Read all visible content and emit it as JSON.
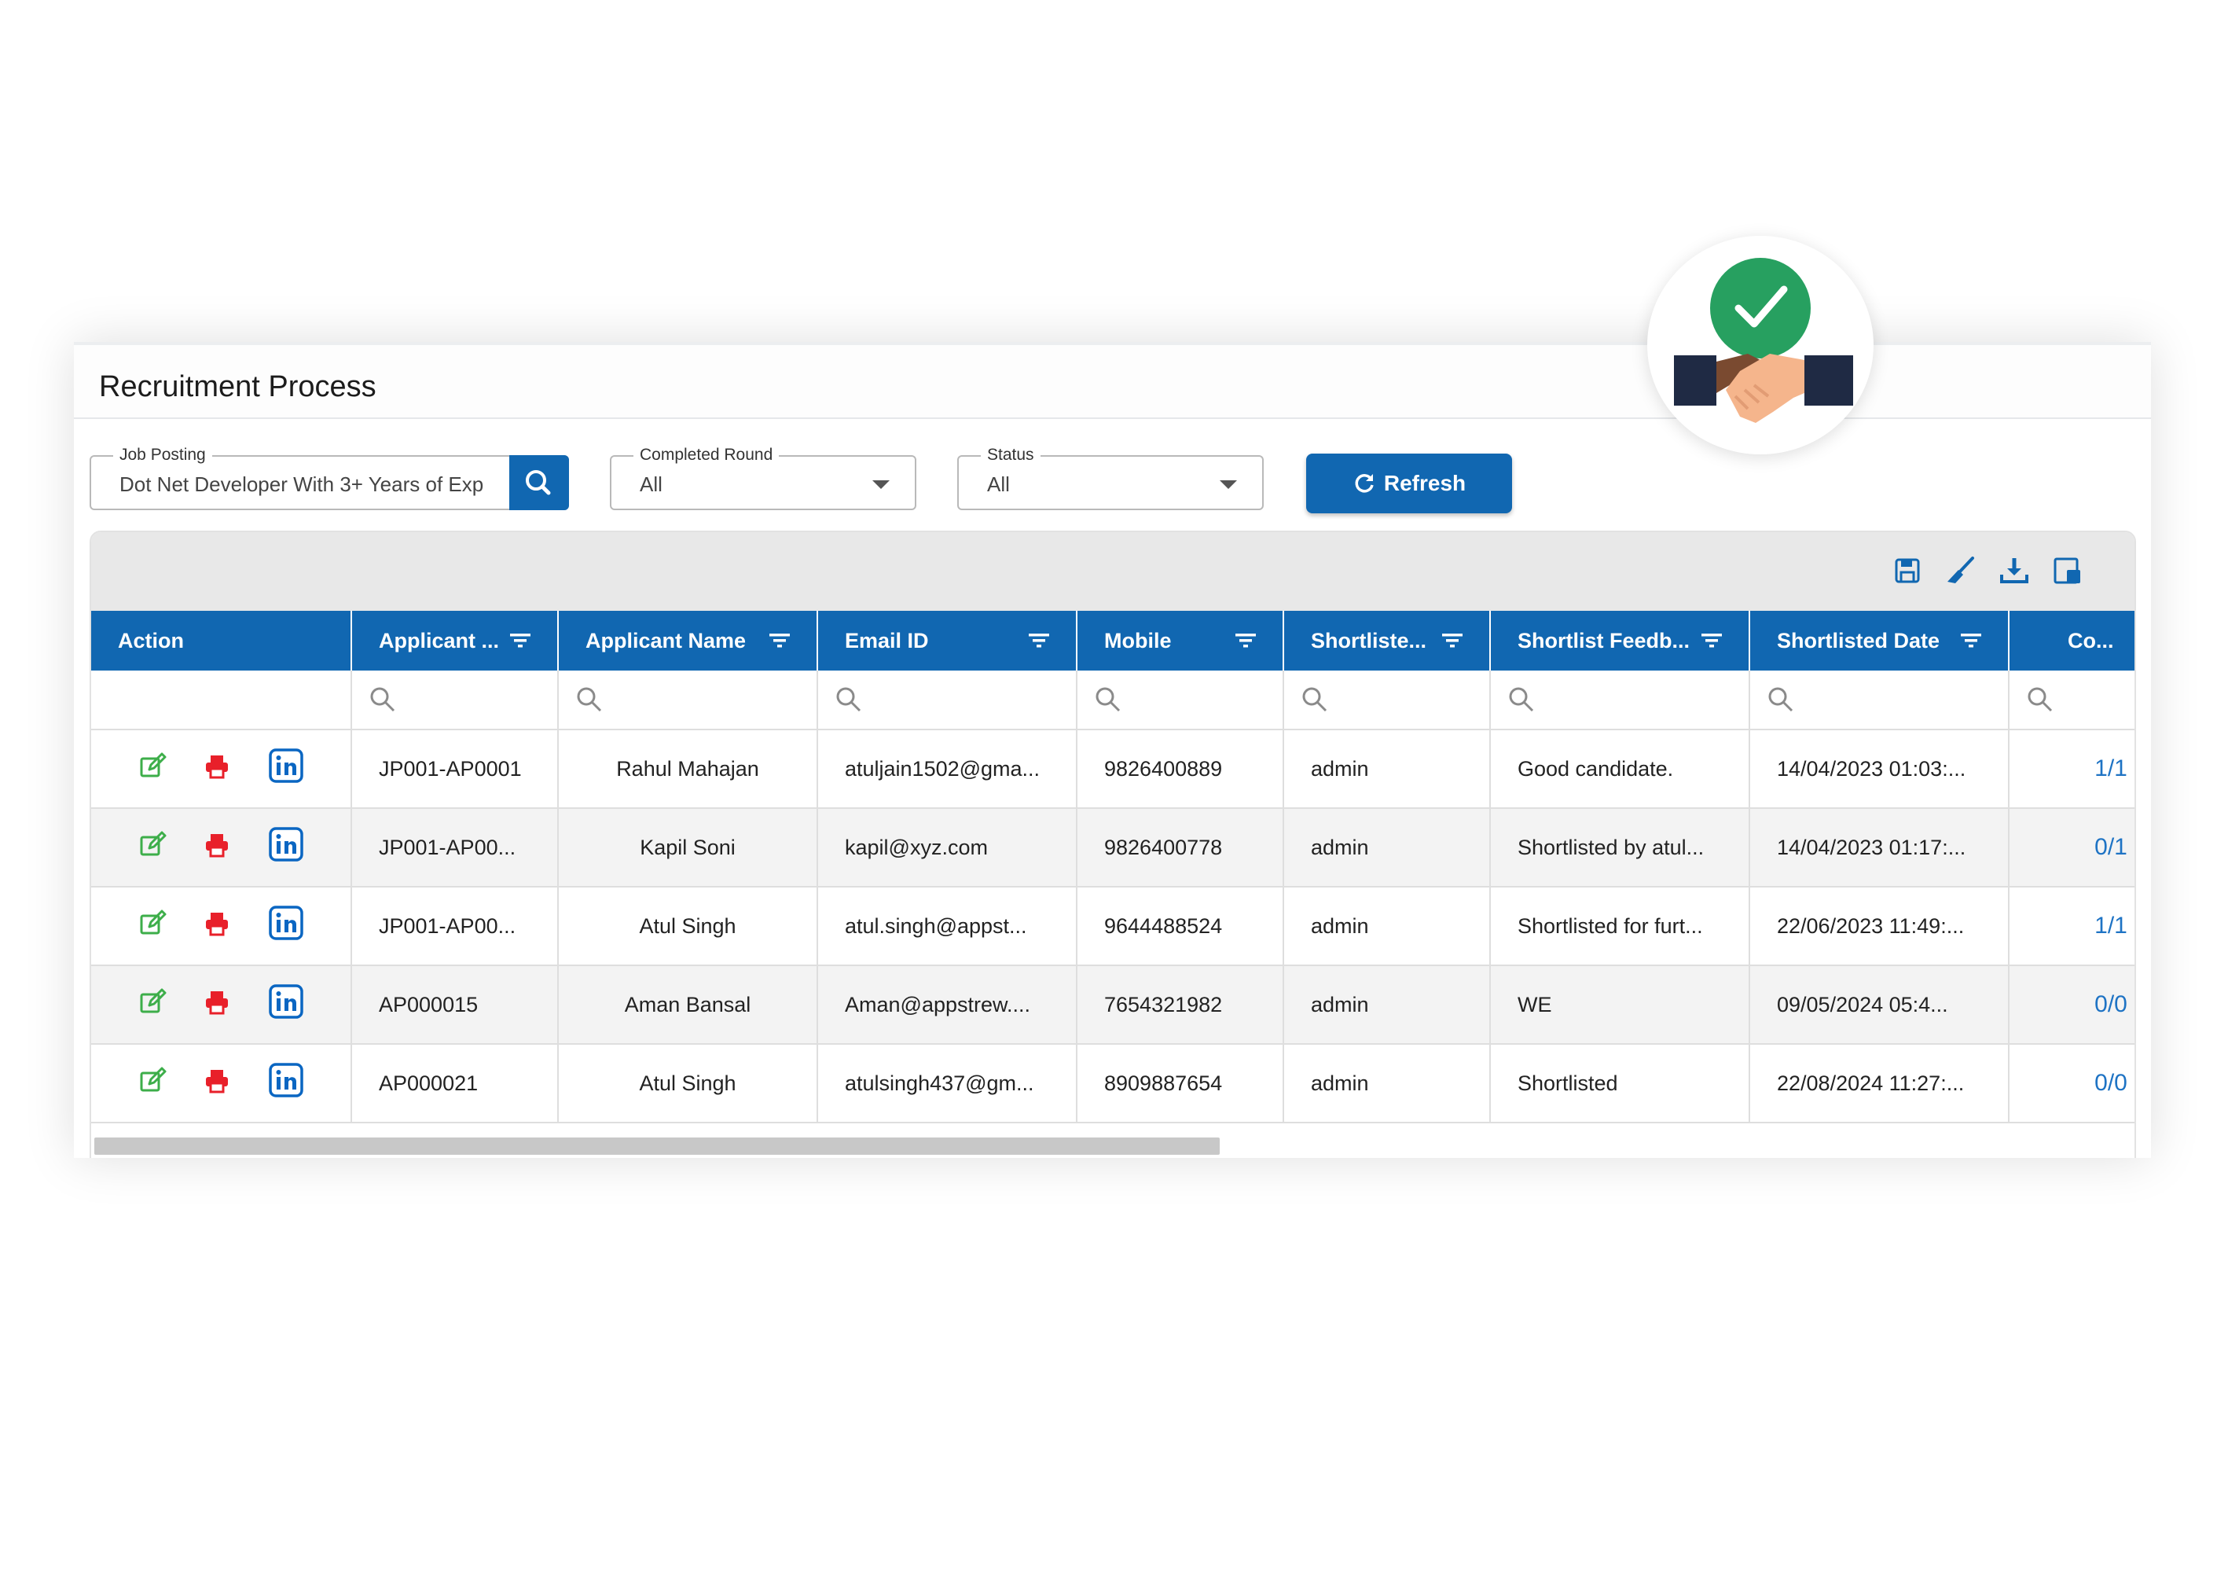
{
  "header": {
    "title": "Recruitment Process"
  },
  "filters": {
    "job_posting": {
      "label": "Job Posting",
      "value": "Dot Net Developer With 3+ Years of Exp"
    },
    "completed_round": {
      "label": "Completed Round",
      "value": "All"
    },
    "status": {
      "label": "Status",
      "value": "All"
    },
    "refresh_label": "Refresh"
  },
  "toolbar": {
    "icons": [
      "save-icon",
      "clear-brush-icon",
      "download-icon",
      "column-chooser-icon"
    ]
  },
  "table": {
    "columns": [
      "Action",
      "Applicant ...",
      "Applicant Name",
      "Email ID",
      "Mobile",
      "Shortliste...",
      "Shortlist Feedb...",
      "Shortlisted Date",
      "Co..."
    ],
    "rows": [
      {
        "applicant_id": "JP001-AP0001",
        "name": "Rahul Mahajan",
        "email": "atuljain1502@gma...",
        "mobile": "9826400889",
        "shortlisted_by": "admin",
        "feedback": "Good candidate.",
        "date": "14/04/2023 01:03:...",
        "rounds": "1/1"
      },
      {
        "applicant_id": "JP001-AP00...",
        "name": "Kapil Soni",
        "email": "kapil@xyz.com",
        "mobile": "9826400778",
        "shortlisted_by": "admin",
        "feedback": "Shortlisted by atul...",
        "date": "14/04/2023 01:17:...",
        "rounds": "0/1"
      },
      {
        "applicant_id": "JP001-AP00...",
        "name": "Atul Singh",
        "email": "atul.singh@appst...",
        "mobile": "9644488524",
        "shortlisted_by": "admin",
        "feedback": "Shortlisted for furt...",
        "date": "22/06/2023 11:49:...",
        "rounds": "1/1"
      },
      {
        "applicant_id": "AP000015",
        "name": "Aman Bansal",
        "email": "Aman@appstrew....",
        "mobile": "7654321982",
        "shortlisted_by": "admin",
        "feedback": "WE",
        "date": "09/05/2024 05:4...",
        "rounds": "0/0"
      },
      {
        "applicant_id": "AP000021",
        "name": "Atul Singh",
        "email": "atulsingh437@gm...",
        "mobile": "8909887654",
        "shortlisted_by": "admin",
        "feedback": "Shortlisted",
        "date": "22/08/2024 11:27:...",
        "rounds": "0/0"
      }
    ]
  },
  "colors": {
    "primary": "#1167b1",
    "edit": "#3dae4a",
    "delete": "#e8202a",
    "linkedin": "#0a66c2",
    "check": "#27a060"
  }
}
